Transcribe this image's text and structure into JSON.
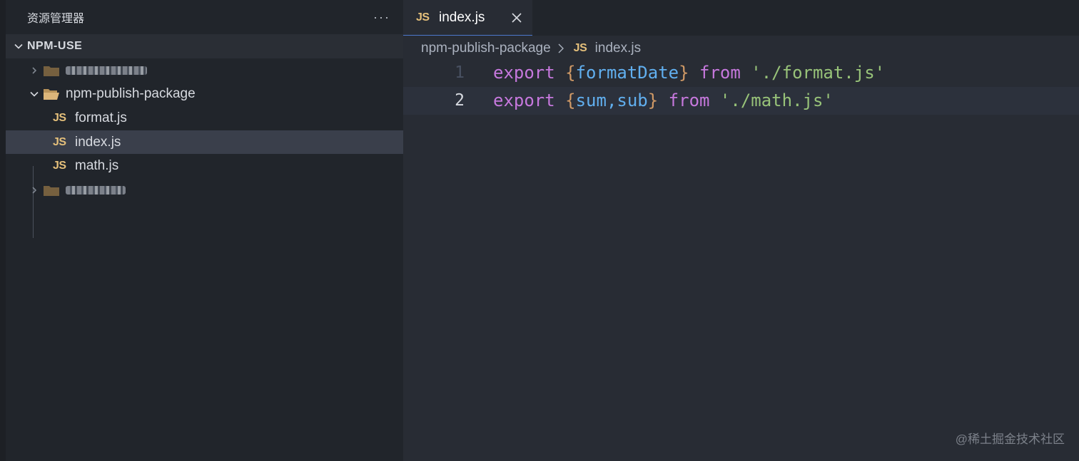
{
  "sidebar": {
    "title": "资源管理器",
    "more_icon": "···",
    "section_title": "NPM-USE",
    "tree": {
      "folder_open_name": "npm-publish-package",
      "files": [
        "format.js",
        "index.js",
        "math.js"
      ],
      "js_badge": "JS"
    }
  },
  "editor": {
    "tab": {
      "label": "index.js",
      "badge": "JS"
    },
    "breadcrumb": {
      "folder": "npm-publish-package",
      "badge": "JS",
      "file": "index.js"
    },
    "lines": [
      {
        "number": "1",
        "kw": "export",
        "open": "{",
        "ids": "formatDate",
        "close": "}",
        "from": "from",
        "str": "'./format.js'"
      },
      {
        "number": "2",
        "kw": "export",
        "open": "{",
        "ids": "sum,sub",
        "close": "}",
        "from": "from",
        "str": "'./math.js'"
      }
    ]
  },
  "watermark": "@稀土掘金技术社区",
  "colors": {
    "keyword": "#c678dd",
    "identifier": "#61afef",
    "bracket": "#d19a66",
    "string": "#98c379",
    "js_badge": "#e5c07b",
    "folder": "#dcb67a"
  }
}
